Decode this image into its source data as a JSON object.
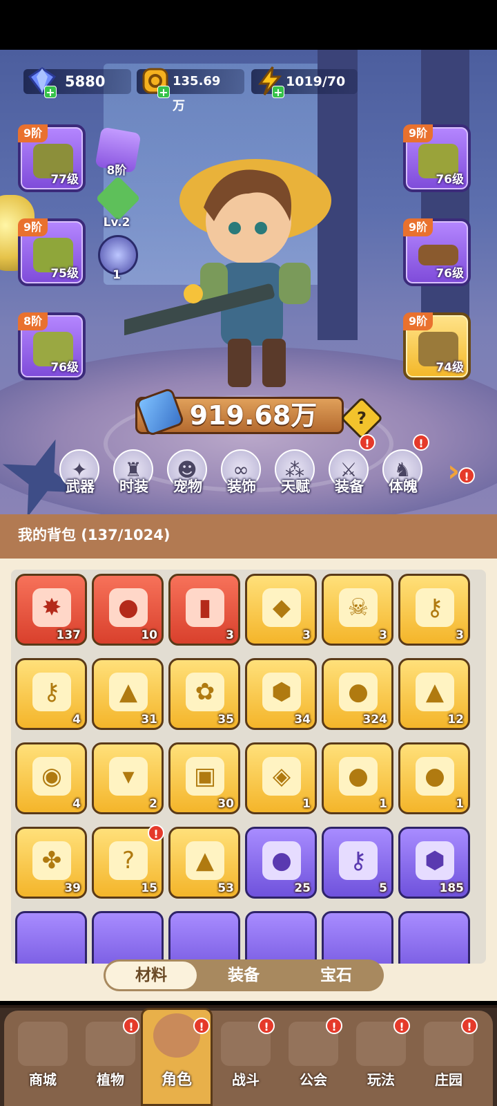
{
  "resources": {
    "gems": "5880",
    "gold": "135.69万",
    "energy": "1019/70"
  },
  "left_slots": [
    {
      "tier": "9阶",
      "level": "77级",
      "icon": "hat-icon"
    },
    {
      "tier": "9阶",
      "level": "75级",
      "icon": "gloves-icon"
    },
    {
      "tier": "8阶",
      "level": "76级",
      "icon": "pants-icon"
    }
  ],
  "right_slots": [
    {
      "tier": "9阶",
      "level": "76级",
      "icon": "shirt-icon"
    },
    {
      "tier": "9阶",
      "level": "76级",
      "icon": "belt-icon"
    },
    {
      "tier": "9阶",
      "level": "74级",
      "icon": "boots-icon"
    }
  ],
  "side_items": {
    "pack_tier": "8阶",
    "gem_level": "Lv.2",
    "orb_count": "1"
  },
  "power": "919.68万",
  "features": [
    {
      "label": "武器",
      "icon": "weapon-icon",
      "badge": false
    },
    {
      "label": "时装",
      "icon": "costume-icon",
      "badge": false
    },
    {
      "label": "宠物",
      "icon": "pet-icon",
      "badge": false
    },
    {
      "label": "装饰",
      "icon": "mask-icon",
      "badge": false
    },
    {
      "label": "天赋",
      "icon": "talent-icon",
      "badge": false
    },
    {
      "label": "装备",
      "icon": "equipment-icon",
      "badge": true
    },
    {
      "label": "体魄",
      "icon": "physique-icon",
      "badge": true
    }
  ],
  "bag": {
    "title": "我的背包 (137/1024)",
    "items": [
      {
        "count": "137",
        "rarity": "red",
        "icon": "crystal-star-icon"
      },
      {
        "count": "10",
        "rarity": "red",
        "icon": "red-potion-icon"
      },
      {
        "count": "3",
        "rarity": "red",
        "icon": "green-vial-icon"
      },
      {
        "count": "3",
        "rarity": "gold",
        "icon": "water-drop-icon"
      },
      {
        "count": "3",
        "rarity": "gold",
        "icon": "skull-scroll-icon"
      },
      {
        "count": "3",
        "rarity": "gold",
        "icon": "golden-key-icon"
      },
      {
        "count": "4",
        "rarity": "gold",
        "icon": "teal-key-icon"
      },
      {
        "count": "31",
        "rarity": "gold",
        "icon": "fire-prism-icon"
      },
      {
        "count": "35",
        "rarity": "gold",
        "icon": "gold-rose-icon"
      },
      {
        "count": "34",
        "rarity": "gold",
        "icon": "rune-stone-icon"
      },
      {
        "count": "324",
        "rarity": "gold",
        "icon": "orange-flask-icon"
      },
      {
        "count": "12",
        "rarity": "gold",
        "icon": "gold-tent-icon"
      },
      {
        "count": "4",
        "rarity": "gold",
        "icon": "ore-icon"
      },
      {
        "count": "2",
        "rarity": "gold",
        "icon": "flower-pot-icon"
      },
      {
        "count": "30",
        "rarity": "gold",
        "icon": "spell-book-icon"
      },
      {
        "count": "1",
        "rarity": "gold",
        "icon": "copper-gem-icon"
      },
      {
        "count": "1",
        "rarity": "gold",
        "icon": "teal-flask-icon"
      },
      {
        "count": "1",
        "rarity": "gold",
        "icon": "red-flask-icon"
      },
      {
        "count": "39",
        "rarity": "gold",
        "icon": "knot-emblem-icon"
      },
      {
        "count": "15",
        "rarity": "gold",
        "icon": "mystery-flask-icon",
        "badge": true
      },
      {
        "count": "53",
        "rarity": "gold",
        "icon": "flame-icon"
      },
      {
        "count": "25",
        "rarity": "purple",
        "icon": "purple-potion-icon"
      },
      {
        "count": "5",
        "rarity": "purple",
        "icon": "silver-key-icon"
      },
      {
        "count": "185",
        "rarity": "purple",
        "icon": "hex-badge-icon"
      }
    ]
  },
  "bag_tabs": [
    "材料",
    "装备",
    "宝石"
  ],
  "active_bag_tab": "材料",
  "nav": [
    {
      "label": "商城",
      "icon": "shop-icon",
      "badge": false
    },
    {
      "label": "植物",
      "icon": "plant-icon",
      "badge": true
    },
    {
      "label": "角色",
      "icon": "hero-icon",
      "badge": true,
      "active": true
    },
    {
      "label": "战斗",
      "icon": "battle-icon",
      "badge": true
    },
    {
      "label": "公会",
      "icon": "guild-icon",
      "badge": true
    },
    {
      "label": "玩法",
      "icon": "gameplay-icon",
      "badge": true
    },
    {
      "label": "庄园",
      "icon": "manor-icon",
      "badge": true
    }
  ],
  "colors": {
    "accent_orange": "#e9712e",
    "epic_purple": "#7e4bd9",
    "legend_gold": "#f4b52a",
    "rare_red": "#d9402c",
    "badge_red": "#e53a2a"
  }
}
